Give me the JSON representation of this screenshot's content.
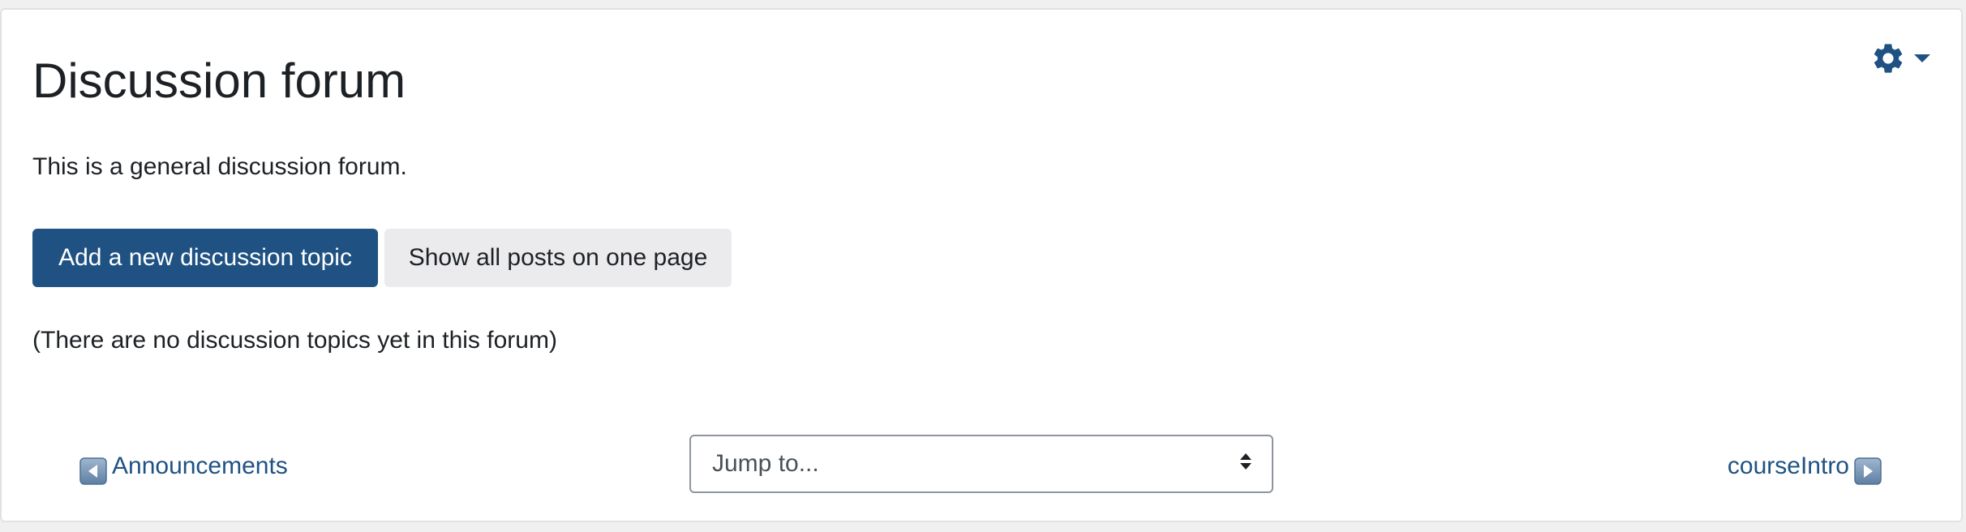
{
  "page": {
    "title": "Discussion forum",
    "intro": "This is a general discussion forum.",
    "empty_note": "(There are no discussion topics yet in this forum)"
  },
  "actions": {
    "add_topic_label": "Add a new discussion topic",
    "show_all_label": "Show all posts on one page"
  },
  "settings_menu": {
    "icon": "gear-icon",
    "caret_icon": "caret-down-icon"
  },
  "navigation": {
    "previous": {
      "label": "Announcements",
      "icon": "arrow-left-icon"
    },
    "next": {
      "label": "courseIntro",
      "icon": "arrow-right-icon"
    },
    "jump_select": {
      "selected": "Jump to..."
    }
  },
  "colors": {
    "primary": "#1f5283",
    "secondary_button": "#ebebed",
    "text": "#1d2125"
  }
}
